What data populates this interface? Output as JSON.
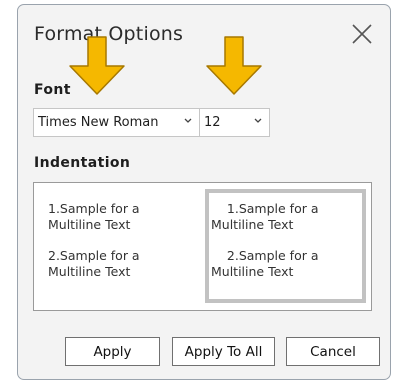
{
  "dialog": {
    "title": "Format Options",
    "font_section_label": "Font",
    "font_select_value": "Times New Roman",
    "size_select_value": "12",
    "indentation_section_label": "Indentation",
    "indent_left": {
      "item1": "1.Sample for a\nMultiline Text",
      "item2": "2.Sample for a\nMultiline Text"
    },
    "indent_right": {
      "item1": "    1.Sample for a\nMultiline Text",
      "item2": "    2.Sample for a\nMultiline Text"
    },
    "buttons": {
      "apply": "Apply",
      "apply_all": "Apply To All",
      "cancel": "Cancel"
    }
  },
  "colors": {
    "annotation_arrow": "#f5b800",
    "selected_border": "#c2c2c2"
  },
  "icons": {
    "close": "close-icon",
    "dropdown": "chevron-down-icon",
    "annotation": "arrow-down-icon"
  }
}
